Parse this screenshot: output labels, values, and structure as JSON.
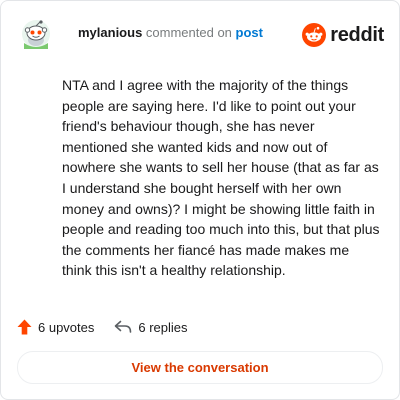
{
  "comment": {
    "author": "mylanious",
    "action_text": "commented on",
    "post_link_text": "post",
    "body": "NTA and I agree with the majority of the things people are saying here. I'd like to point out your friend's behaviour though, she has never mentioned she wanted kids and now out of nowhere she wants to sell her house (that as far as I understand she bought herself with her own money and owns)? I might be showing little faith in people and reading too much into this, but that plus the comments her fiancé has made makes me think this isn't a healthy relationship."
  },
  "brand": {
    "wordmark": "reddit",
    "color": "#ff4500"
  },
  "stats": {
    "upvotes": "6 upvotes",
    "replies": "6 replies"
  },
  "cta": {
    "label": "View the conversation",
    "color": "#d93900"
  },
  "icons": {
    "avatar": "snoo-avatar-icon",
    "logo": "reddit-snoo-icon",
    "upvote": "upvote-arrow-icon",
    "reply": "reply-arrow-icon"
  }
}
